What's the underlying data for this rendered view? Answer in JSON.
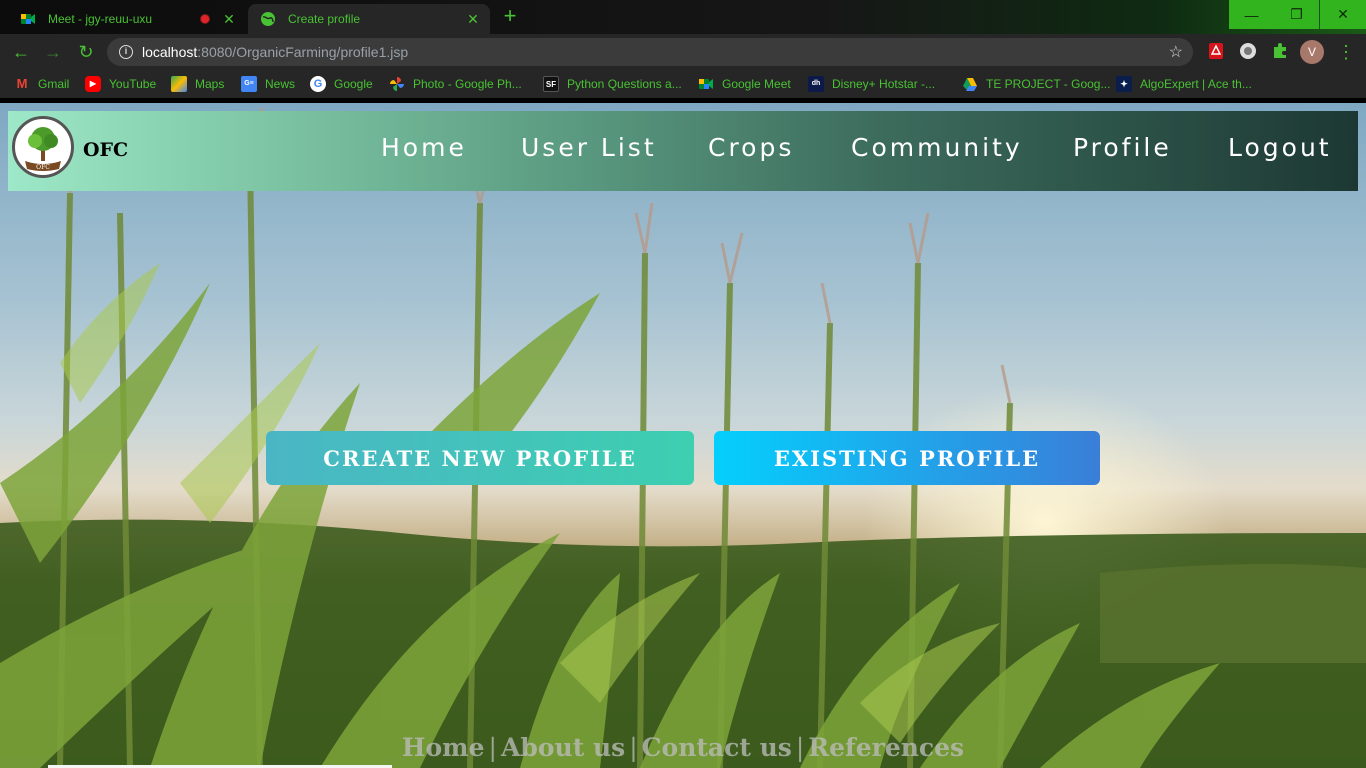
{
  "browser": {
    "tabs": [
      {
        "title": "Meet - jgy-reuu-uxu",
        "recording": true,
        "icon": "google-meet-icon"
      },
      {
        "title": "Create profile",
        "icon": "globe-icon"
      }
    ],
    "address": {
      "host": "localhost",
      "path": ":8080/OrganicFarming/profile1.jsp"
    },
    "profile_initial": "V",
    "bookmarks": [
      {
        "label": "Gmail",
        "icon": "gmail-icon"
      },
      {
        "label": "YouTube",
        "icon": "youtube-icon"
      },
      {
        "label": "Maps",
        "icon": "maps-icon"
      },
      {
        "label": "News",
        "icon": "news-icon"
      },
      {
        "label": "Google",
        "icon": "google-icon"
      },
      {
        "label": "Photo - Google Ph...",
        "icon": "photos-icon"
      },
      {
        "label": "Python Questions a...",
        "icon": "sf-icon"
      },
      {
        "label": "Google Meet",
        "icon": "google-meet-icon"
      },
      {
        "label": "Disney+ Hotstar -...",
        "icon": "hotstar-icon"
      },
      {
        "label": "TE PROJECT - Goog...",
        "icon": "drive-icon"
      },
      {
        "label": "AlgoExpert | Ace th...",
        "icon": "algoexpert-icon"
      }
    ],
    "accent": "#49c233"
  },
  "site": {
    "brand": "OFC",
    "nav": [
      "Home",
      "User List",
      "Crops",
      "Community",
      "Profile",
      "Logout"
    ],
    "buttons": {
      "create": "CREATE NEW PROFILE",
      "existing": "EXISTING PROFILE"
    },
    "footer": {
      "links": [
        "Home",
        "About us",
        "Contact us",
        "References"
      ],
      "separator": "|"
    }
  }
}
